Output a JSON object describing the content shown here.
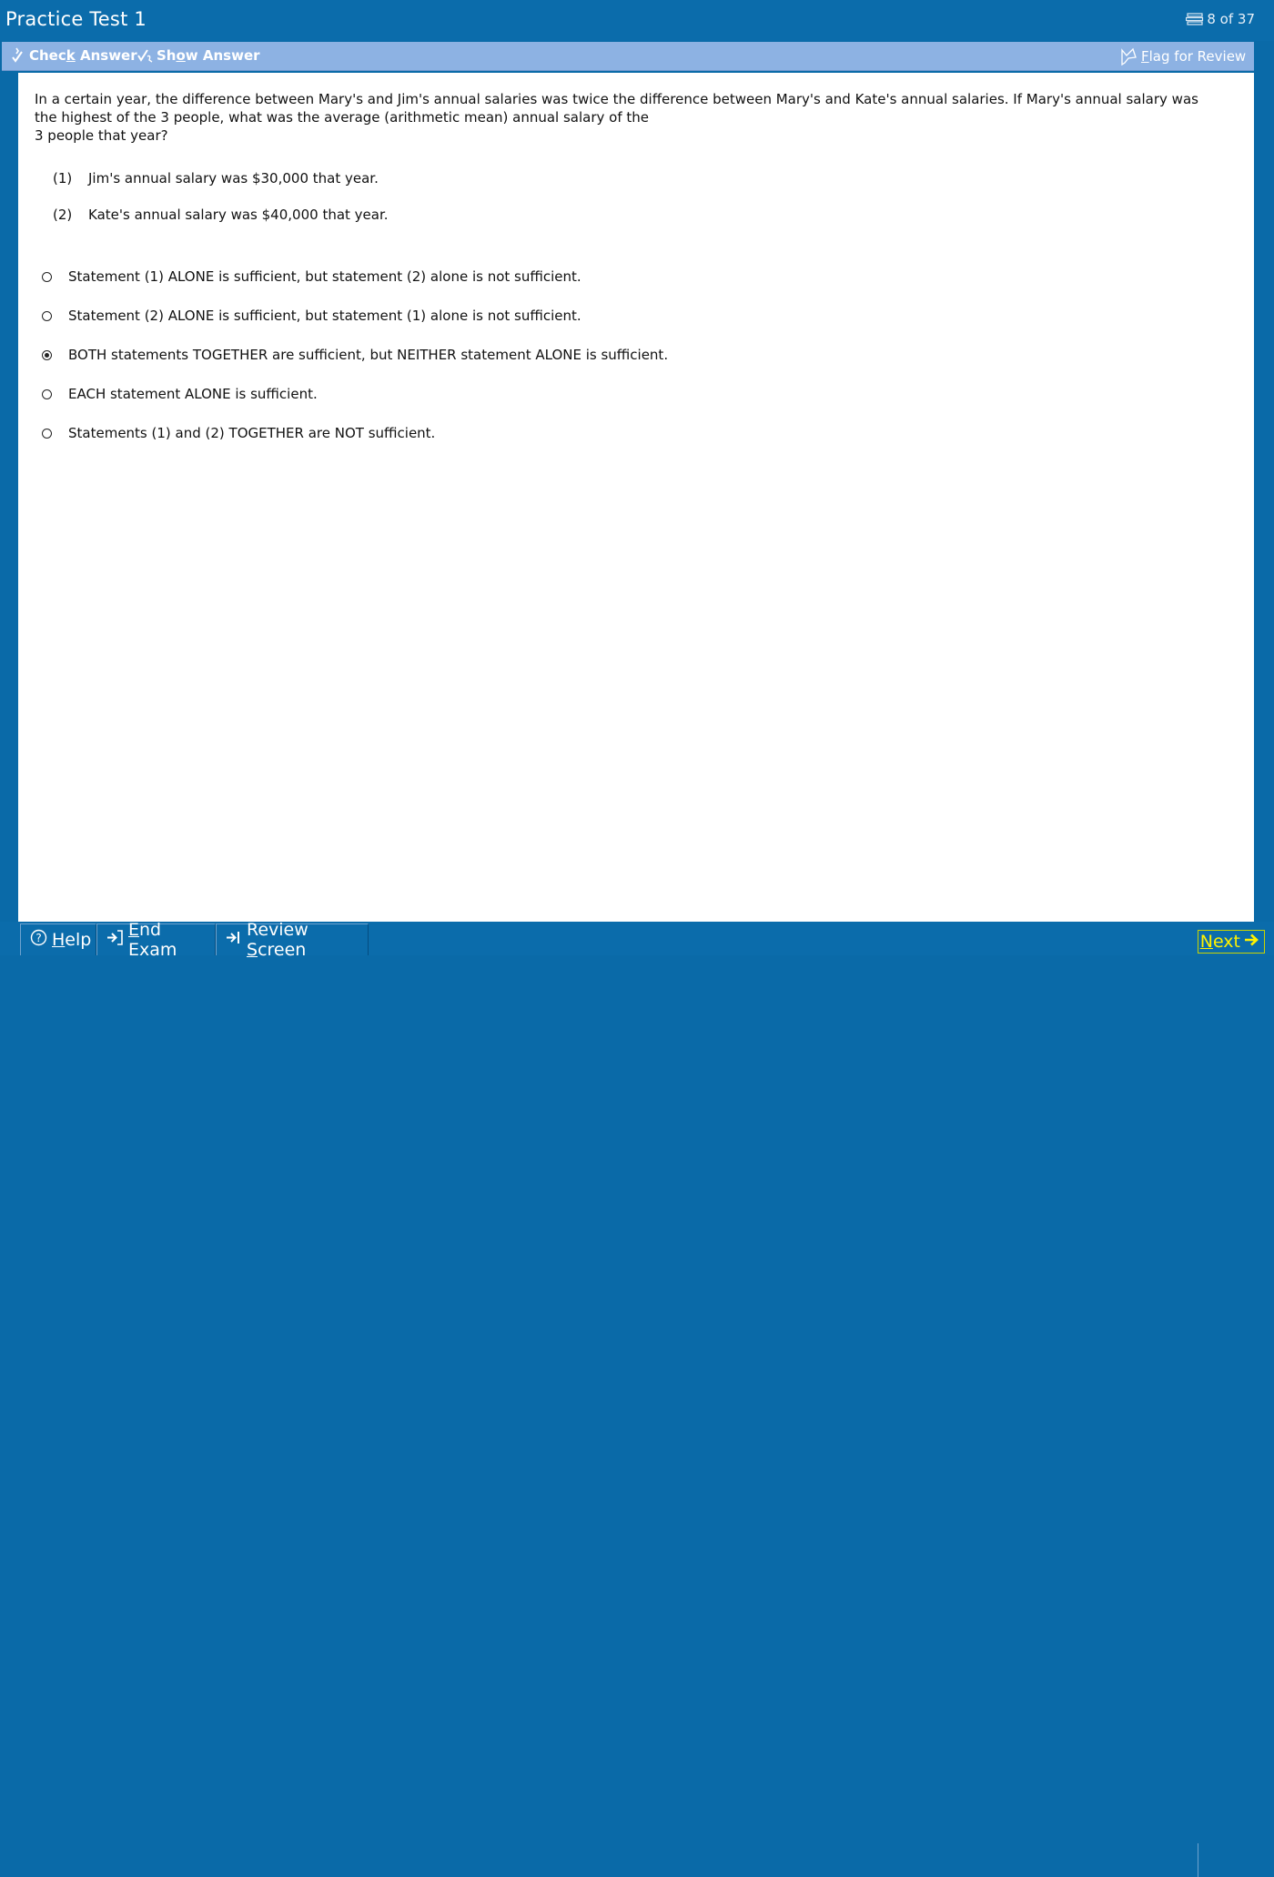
{
  "header": {
    "title": "Practice Test 1",
    "counter": "8 of 37"
  },
  "toolbar": {
    "check_answer_pre": "Chec",
    "check_answer_u": "k",
    "check_answer_post": " Answer",
    "show_answer_pre": "Sh",
    "show_answer_u": "o",
    "show_answer_post": "w Answer",
    "flag_u": "F",
    "flag_post": "lag for Review"
  },
  "question": {
    "line1": "In a certain year, the difference between Mary's and Jim's annual salaries was twice the difference between Mary's and Kate's annual salaries.  If Mary's annual salary was the highest of the 3 people, what was the average (arithmetic mean) annual salary of the",
    "line2": "3 people that year?",
    "statements": [
      {
        "num": "(1)",
        "text": "Jim's annual salary was $30,000 that year."
      },
      {
        "num": "(2)",
        "text": "Kate's annual salary was $40,000 that year."
      }
    ],
    "choices": [
      {
        "text": "Statement (1) ALONE is sufficient, but statement (2) alone is not sufficient.",
        "selected": false
      },
      {
        "text": "Statement (2) ALONE is sufficient, but statement (1) alone is not sufficient.",
        "selected": false
      },
      {
        "text": "BOTH statements TOGETHER are sufficient, but NEITHER statement ALONE is sufficient.",
        "selected": true
      },
      {
        "text": "EACH statement ALONE is sufficient.",
        "selected": false
      },
      {
        "text": "Statements (1) and (2) TOGETHER are NOT sufficient.",
        "selected": false
      }
    ]
  },
  "footer": {
    "help_u": "H",
    "help_post": "elp",
    "end_exam_u": "E",
    "end_exam_post": "nd Exam",
    "review_pre": "Review ",
    "review_u": "S",
    "review_post": "creen",
    "next_u": "N",
    "next_post": "ext"
  },
  "colors": {
    "frame": "#0b6cab",
    "toolbar": "#8db2e3",
    "next_text": "#fff200"
  }
}
